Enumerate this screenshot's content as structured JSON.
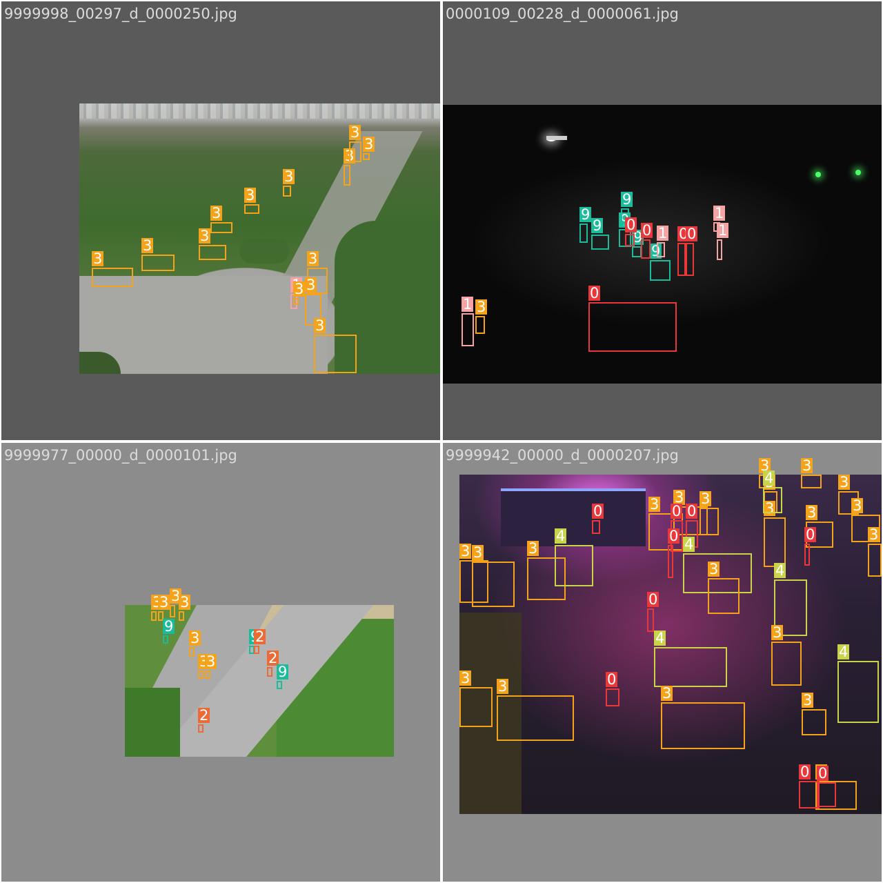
{
  "colors": {
    "class_0": "#e8383c",
    "class_1": "#f5a3a3",
    "class_2": "#ec6a35",
    "class_3": "#f5a31a",
    "class_4": "#c9d44a",
    "class_9": "#1abc9c"
  },
  "tiles": [
    {
      "filename": "9999998_00297_d_0000250.jpg",
      "boxes": [
        {
          "cls": "3"
        },
        {
          "cls": "3"
        },
        {
          "cls": "3"
        },
        {
          "cls": "3"
        },
        {
          "cls": "3"
        },
        {
          "cls": "3"
        },
        {
          "cls": "3"
        },
        {
          "cls": "3"
        },
        {
          "cls": "3"
        },
        {
          "cls": "3"
        },
        {
          "cls": "3"
        },
        {
          "cls": "3"
        },
        {
          "cls": "1"
        },
        {
          "cls": "3"
        }
      ]
    },
    {
      "filename": "0000109_00228_d_0000061.jpg",
      "boxes": [
        {
          "cls": "9"
        },
        {
          "cls": "9"
        },
        {
          "cls": "9"
        },
        {
          "cls": "9"
        },
        {
          "cls": "9"
        },
        {
          "cls": "9"
        },
        {
          "cls": "0"
        },
        {
          "cls": "0"
        },
        {
          "cls": "1"
        },
        {
          "cls": "0"
        },
        {
          "cls": "0"
        },
        {
          "cls": "1"
        },
        {
          "cls": "1"
        },
        {
          "cls": "1"
        },
        {
          "cls": "3"
        },
        {
          "cls": "0"
        }
      ]
    },
    {
      "filename": "9999977_00000_d_0000101.jpg",
      "boxes": [
        {
          "cls": "3"
        },
        {
          "cls": "3"
        },
        {
          "cls": "3"
        },
        {
          "cls": "3"
        },
        {
          "cls": "9"
        },
        {
          "cls": "3"
        },
        {
          "cls": "3"
        },
        {
          "cls": "3"
        },
        {
          "cls": "9"
        },
        {
          "cls": "2"
        },
        {
          "cls": "2"
        },
        {
          "cls": "9"
        },
        {
          "cls": "2"
        }
      ]
    },
    {
      "filename": "9999942_00000_d_0000207.jpg",
      "boxes": [
        {
          "cls": "3"
        },
        {
          "cls": "3"
        },
        {
          "cls": "3"
        },
        {
          "cls": "3"
        },
        {
          "cls": "3"
        },
        {
          "cls": "3"
        },
        {
          "cls": "3"
        },
        {
          "cls": "3"
        },
        {
          "cls": "3"
        },
        {
          "cls": "3"
        },
        {
          "cls": "0"
        },
        {
          "cls": "3"
        },
        {
          "cls": "3"
        },
        {
          "cls": "0"
        },
        {
          "cls": "0"
        },
        {
          "cls": "4"
        },
        {
          "cls": "4"
        },
        {
          "cls": "3"
        },
        {
          "cls": "3"
        },
        {
          "cls": "3"
        },
        {
          "cls": "4"
        },
        {
          "cls": "4"
        },
        {
          "cls": "4"
        },
        {
          "cls": "0"
        },
        {
          "cls": "3"
        },
        {
          "cls": "0"
        },
        {
          "cls": "0"
        },
        {
          "cls": "4"
        },
        {
          "cls": "3"
        },
        {
          "cls": "3"
        },
        {
          "cls": "3"
        },
        {
          "cls": "0"
        },
        {
          "cls": "3"
        },
        {
          "cls": "3"
        },
        {
          "cls": "0"
        },
        {
          "cls": "0"
        }
      ]
    }
  ]
}
